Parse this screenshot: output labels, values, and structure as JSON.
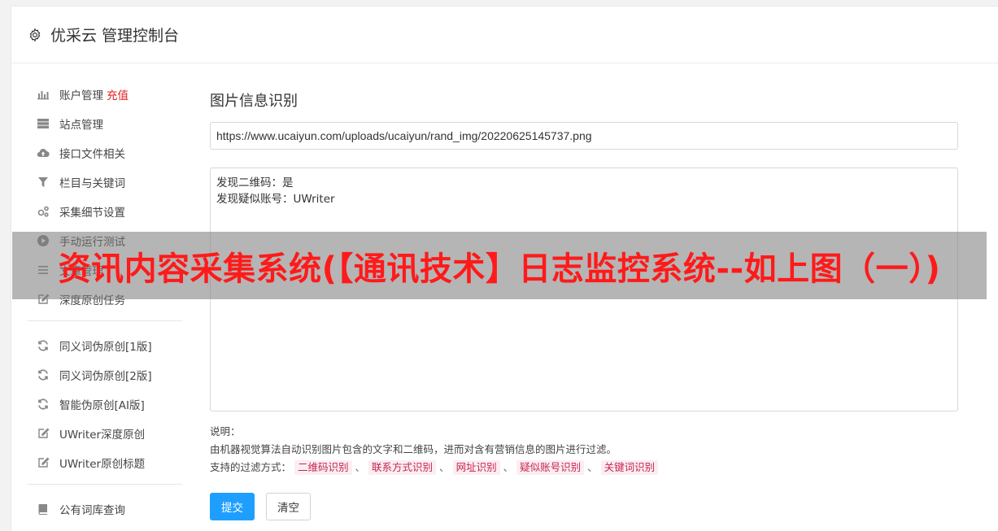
{
  "header": {
    "title": "优采云 管理控制台"
  },
  "sidebar": {
    "group1": [
      {
        "label": "账户管理",
        "badge": "充值",
        "icon": "bar-chart-icon"
      },
      {
        "label": "站点管理",
        "icon": "server-icon"
      },
      {
        "label": "接口文件相关",
        "icon": "cloud-upload-icon"
      },
      {
        "label": "栏目与关键词",
        "icon": "filter-icon"
      },
      {
        "label": "采集细节设置",
        "icon": "cogs-icon"
      },
      {
        "label": "手动运行测试",
        "icon": "play-icon"
      },
      {
        "label": "文章管理",
        "icon": "list-icon"
      },
      {
        "label": "深度原创任务",
        "icon": "edit-icon"
      }
    ],
    "group2": [
      {
        "label": "同义词伪原创[1版]",
        "icon": "refresh-icon"
      },
      {
        "label": "同义词伪原创[2版]",
        "icon": "refresh-icon"
      },
      {
        "label": "智能伪原创[AI版]",
        "icon": "refresh-icon"
      },
      {
        "label": "UWriter深度原创",
        "icon": "edit-icon"
      },
      {
        "label": "UWriter原创标题",
        "icon": "edit-icon"
      }
    ],
    "group3": [
      {
        "label": "公有词库查询",
        "icon": "book-icon"
      }
    ]
  },
  "main": {
    "title": "图片信息识别",
    "url_value": "https://www.ucaiyun.com/uploads/ucaiyun/rand_img/20220625145737.png",
    "result_lines": [
      "发现二维码：是",
      "发现疑似账号：UWriter"
    ],
    "desc_label": "说明：",
    "desc_text": "由机器视觉算法自动识别图片包含的文字和二维码，进而对含有营销信息的图片进行过滤。",
    "filter_label": "支持的过滤方式：",
    "filters": [
      "二维码识别",
      "联系方式识别",
      "网址识别",
      "疑似账号识别",
      "关键词识别"
    ],
    "filter_separator": "、",
    "submit_label": "提交",
    "clear_label": "清空"
  },
  "overlay": {
    "text": "资讯内容采集系统(【通讯技术】日志监控系统--如上图（一）)"
  }
}
